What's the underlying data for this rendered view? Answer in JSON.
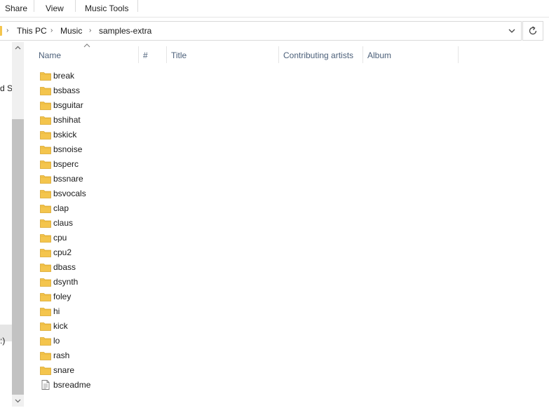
{
  "ribbon": {
    "tabs": [
      {
        "label": "Share"
      },
      {
        "label": "View"
      },
      {
        "label": "Music Tools"
      }
    ]
  },
  "address": {
    "crumbs": [
      "This PC",
      "Music",
      "samples-extra"
    ]
  },
  "nav": {
    "partial_texts": [
      "d S",
      ":)"
    ]
  },
  "columns": {
    "name": "Name",
    "number": "#",
    "title": "Title",
    "artists": "Contributing artists",
    "album": "Album"
  },
  "items": [
    {
      "name": "break",
      "kind": "folder"
    },
    {
      "name": "bsbass",
      "kind": "folder"
    },
    {
      "name": "bsguitar",
      "kind": "folder"
    },
    {
      "name": "bshihat",
      "kind": "folder"
    },
    {
      "name": "bskick",
      "kind": "folder"
    },
    {
      "name": "bsnoise",
      "kind": "folder"
    },
    {
      "name": "bsperc",
      "kind": "folder"
    },
    {
      "name": "bssnare",
      "kind": "folder"
    },
    {
      "name": "bsvocals",
      "kind": "folder"
    },
    {
      "name": "clap",
      "kind": "folder"
    },
    {
      "name": "claus",
      "kind": "folder"
    },
    {
      "name": "cpu",
      "kind": "folder"
    },
    {
      "name": "cpu2",
      "kind": "folder"
    },
    {
      "name": "dbass",
      "kind": "folder"
    },
    {
      "name": "dsynth",
      "kind": "folder"
    },
    {
      "name": "foley",
      "kind": "folder"
    },
    {
      "name": "hi",
      "kind": "folder"
    },
    {
      "name": "kick",
      "kind": "folder"
    },
    {
      "name": "lo",
      "kind": "folder"
    },
    {
      "name": "rash",
      "kind": "folder"
    },
    {
      "name": "snare",
      "kind": "folder"
    },
    {
      "name": "bsreadme",
      "kind": "text-file"
    }
  ],
  "colors": {
    "folder": "#f4c54d",
    "header_text": "#4c607a"
  }
}
